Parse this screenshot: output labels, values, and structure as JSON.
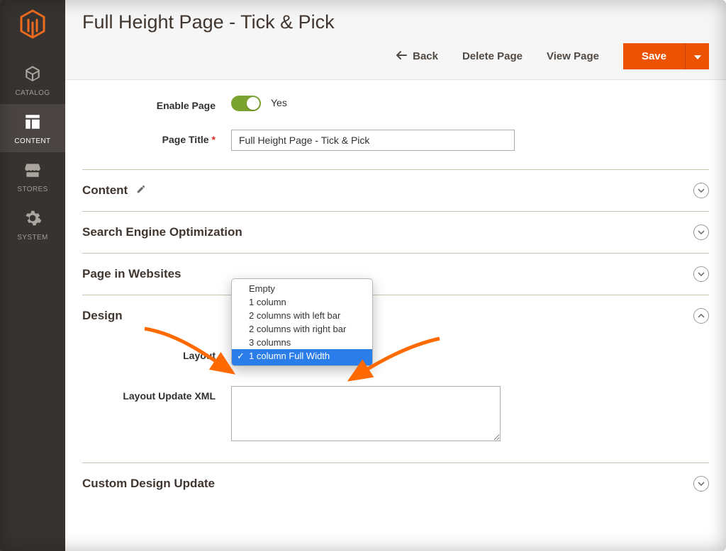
{
  "sidebar": {
    "items": [
      {
        "key": "catalog",
        "label": "CATALOG"
      },
      {
        "key": "content",
        "label": "CONTENT"
      },
      {
        "key": "stores",
        "label": "STORES"
      },
      {
        "key": "system",
        "label": "SYSTEM"
      }
    ]
  },
  "header": {
    "title": "Full Height Page - Tick & Pick",
    "actions": {
      "back": "Back",
      "delete": "Delete Page",
      "view": "View Page",
      "save": "Save"
    }
  },
  "form": {
    "enable_label": "Enable Page",
    "enable_value": "Yes",
    "title_label": "Page Title",
    "title_value": "Full Height Page - Tick & Pick"
  },
  "sections": {
    "content": "Content",
    "seo": "Search Engine Optimization",
    "pageinweb": "Page in Websites",
    "design": "Design",
    "customdesign": "Custom Design Update"
  },
  "design": {
    "layout_label": "Layout",
    "layout_xml_label": "Layout Update XML",
    "layout_options": [
      "Empty",
      "1 column",
      "2 columns with left bar",
      "2 columns with right bar",
      "3 columns",
      "1 column Full Width"
    ],
    "layout_selected": "1 column Full Width"
  }
}
